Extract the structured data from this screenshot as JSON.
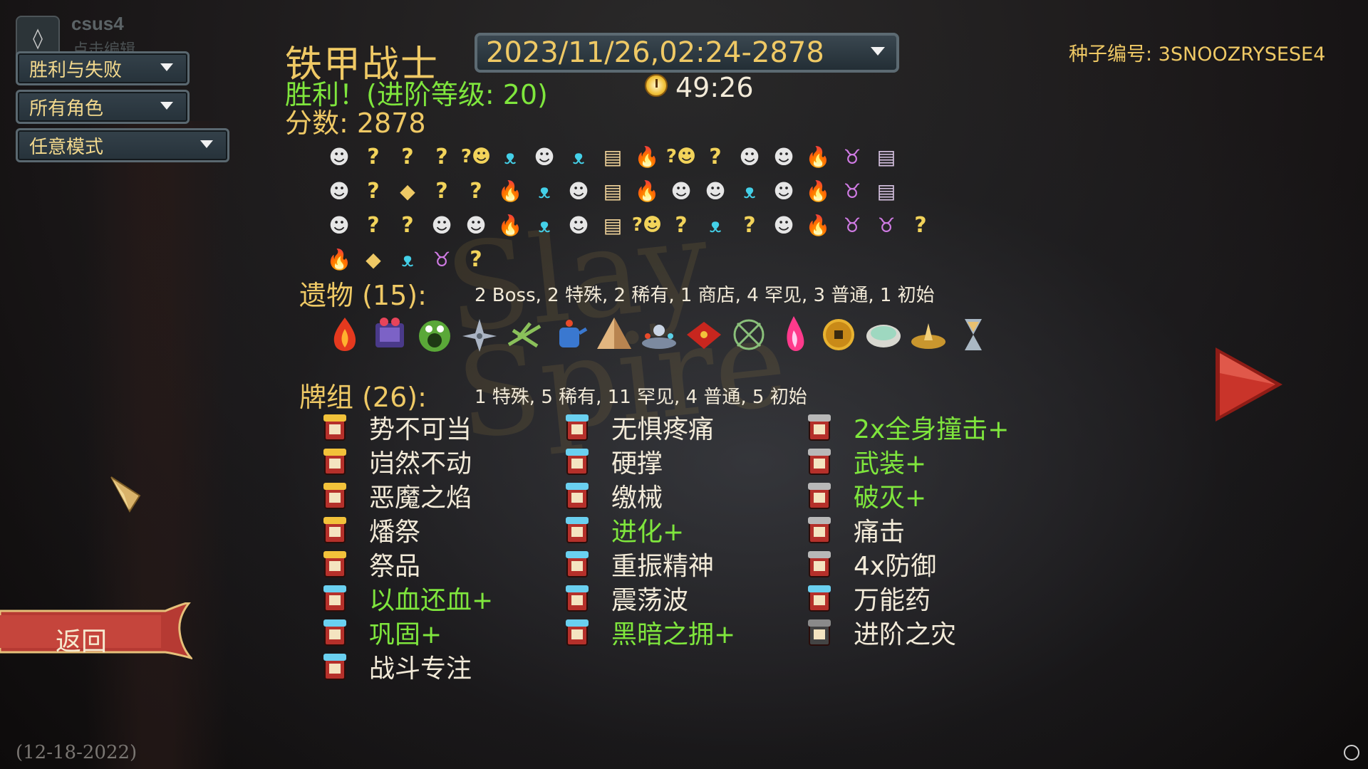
{
  "profile": {
    "name": "csus4",
    "edit_hint": "点击编辑"
  },
  "filters": {
    "outcome": "胜利与失败",
    "character": "所有角色",
    "mode": "任意模式"
  },
  "run": {
    "character": "铁甲战士",
    "date_selector": "2023/11/26,02:24-2878",
    "result": "胜利！(进阶等级: 20)",
    "play_time": "49:26",
    "score": "分数: 2878",
    "seed": "种子编号: 3SNOOZRYSESE4"
  },
  "path_rows": [
    [
      "monster",
      "unknown",
      "unknown",
      "unknown",
      "unknown-monster",
      "elite",
      "monster",
      "elite",
      "treasure",
      "rest",
      "unknown-monster",
      "unknown",
      "monster",
      "monster",
      "rest",
      "boss",
      "chest"
    ],
    [
      "monster",
      "unknown",
      "shop",
      "unknown",
      "unknown",
      "rest",
      "elite",
      "monster",
      "treasure",
      "rest",
      "monster",
      "monster",
      "elite",
      "monster",
      "rest",
      "boss",
      "chest"
    ],
    [
      "monster",
      "unknown",
      "unknown",
      "monster",
      "monster",
      "rest",
      "elite",
      "monster",
      "treasure",
      "unknown-monster",
      "unknown",
      "elite",
      "unknown",
      "monster",
      "rest",
      "boss",
      "boss",
      "unknown"
    ],
    [
      "rest",
      "shop",
      "elite",
      "boss",
      "unknown"
    ]
  ],
  "path_legend": {
    "monster": "☻",
    "unknown": "?",
    "elite": "ᴥ",
    "rest": "🔥",
    "boss": "♉",
    "treasure": "▤",
    "chest": "▤",
    "shop": "◆",
    "unknown-monster": "?☻"
  },
  "relics": {
    "label": "遗物 (15):",
    "summary": "2 Boss, 2 特殊, 2 稀有, 1 商店, 4 罕见, 3 普通, 1 初始",
    "items": [
      "burning-blood",
      "runic-cube",
      "membership-frog",
      "shuriken",
      "twigs",
      "kettle",
      "pyramid",
      "orrery",
      "pillow",
      "clover-web",
      "crimson-fire",
      "ancient-coin",
      "shell",
      "sundial",
      "hourglass"
    ]
  },
  "deck": {
    "label": "牌组 (26):",
    "summary": "1 特殊, 5 稀有, 11 罕见, 4 普通, 5 初始",
    "columns": [
      [
        {
          "name": "势不可当",
          "upgraded": false,
          "type": "skill",
          "rarity": "rare"
        },
        {
          "name": "岿然不动",
          "upgraded": false,
          "type": "power",
          "rarity": "rare"
        },
        {
          "name": "恶魔之焰",
          "upgraded": false,
          "type": "attack",
          "rarity": "rare"
        },
        {
          "name": "燔祭",
          "upgraded": false,
          "type": "attack",
          "rarity": "rare"
        },
        {
          "name": "祭品",
          "upgraded": false,
          "type": "skill",
          "rarity": "rare"
        },
        {
          "name": "以血还血+",
          "upgraded": true,
          "type": "attack",
          "rarity": "uncommon"
        },
        {
          "name": "巩固+",
          "upgraded": true,
          "type": "skill",
          "rarity": "uncommon"
        },
        {
          "name": "战斗专注",
          "upgraded": false,
          "type": "skill",
          "rarity": "uncommon"
        }
      ],
      [
        {
          "name": "无惧疼痛",
          "upgraded": false,
          "type": "power",
          "rarity": "uncommon"
        },
        {
          "name": "硬撑",
          "upgraded": false,
          "type": "skill",
          "rarity": "uncommon"
        },
        {
          "name": "缴械",
          "upgraded": false,
          "type": "skill",
          "rarity": "uncommon"
        },
        {
          "name": "进化+",
          "upgraded": true,
          "type": "power",
          "rarity": "uncommon"
        },
        {
          "name": "重振精神",
          "upgraded": false,
          "type": "skill",
          "rarity": "uncommon"
        },
        {
          "name": "震荡波",
          "upgraded": false,
          "type": "skill",
          "rarity": "uncommon"
        },
        {
          "name": "黑暗之拥+",
          "upgraded": true,
          "type": "power",
          "rarity": "uncommon"
        }
      ],
      [
        {
          "name": "2x全身撞击+",
          "upgraded": true,
          "type": "attack",
          "rarity": "common"
        },
        {
          "name": "武装+",
          "upgraded": true,
          "type": "skill",
          "rarity": "common"
        },
        {
          "name": "破灭+",
          "upgraded": true,
          "type": "attack",
          "rarity": "common"
        },
        {
          "name": "痛击",
          "upgraded": false,
          "type": "attack",
          "rarity": "basic"
        },
        {
          "name": "4x防御",
          "upgraded": false,
          "type": "skill",
          "rarity": "basic"
        },
        {
          "name": "万能药",
          "upgraded": false,
          "type": "skill",
          "rarity": "special"
        },
        {
          "name": "进阶之灾",
          "upgraded": false,
          "type": "curse",
          "rarity": "curse"
        }
      ]
    ]
  },
  "footer": {
    "return_label": "返回",
    "version": "(12-18-2022)"
  },
  "colors": {
    "gold": "#efc965",
    "green": "#7fe63d",
    "banner": "#b93c36"
  }
}
